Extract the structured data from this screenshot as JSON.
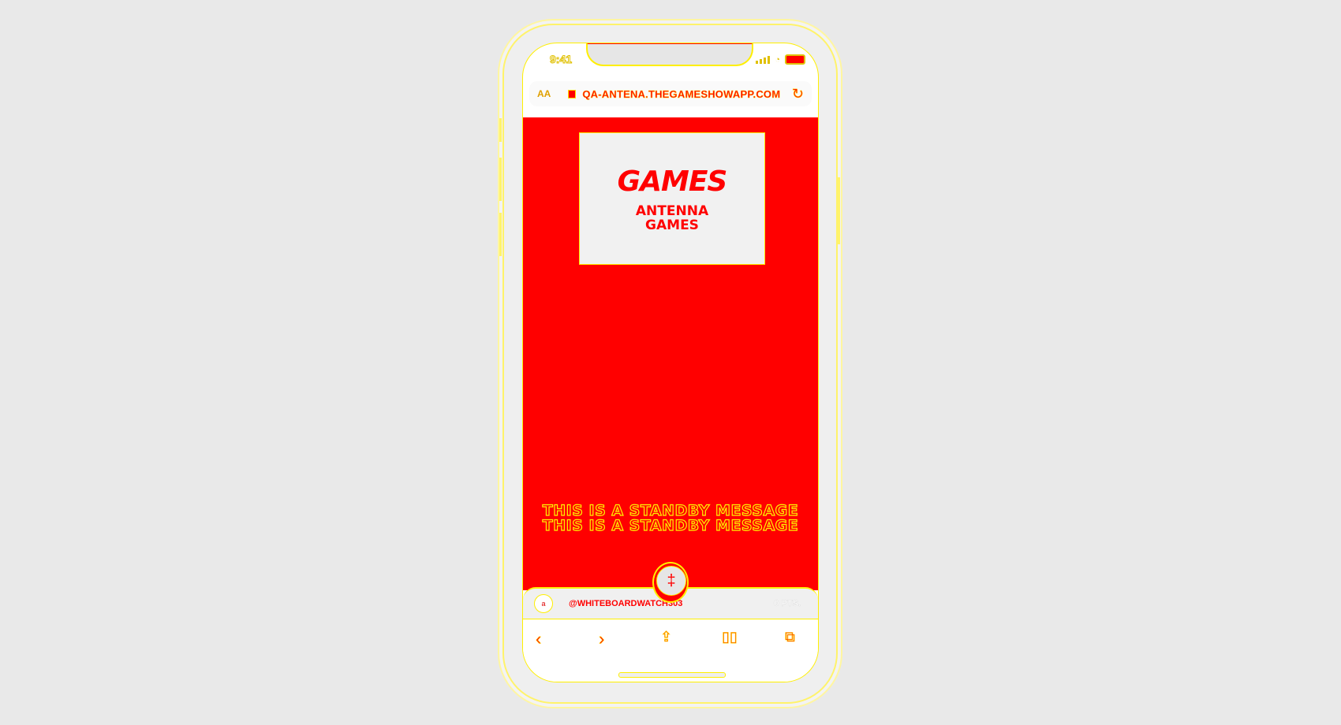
{
  "status_bar": {
    "time": "9:41"
  },
  "browser": {
    "text_size_label": "AA",
    "url": "QA-ANTENA.THEGAMESHOWAPP.COM"
  },
  "logo": {
    "title": "GAMES",
    "subtitle": "ANTENNA GAMES"
  },
  "standby": {
    "line1": "THIS IS A STANDBY MESSAGE",
    "line2": "THIS IS A STANDBY MESSAGE"
  },
  "player": {
    "avatar_initial": "a",
    "handle": "@WHITEBOARDWATCH303",
    "points": "0 PTS."
  },
  "fab": {
    "icon_label": "‡"
  },
  "colors": {
    "accent": "#ff0000",
    "outline": "#ffef00",
    "page_bg": "#e9e9e9"
  }
}
